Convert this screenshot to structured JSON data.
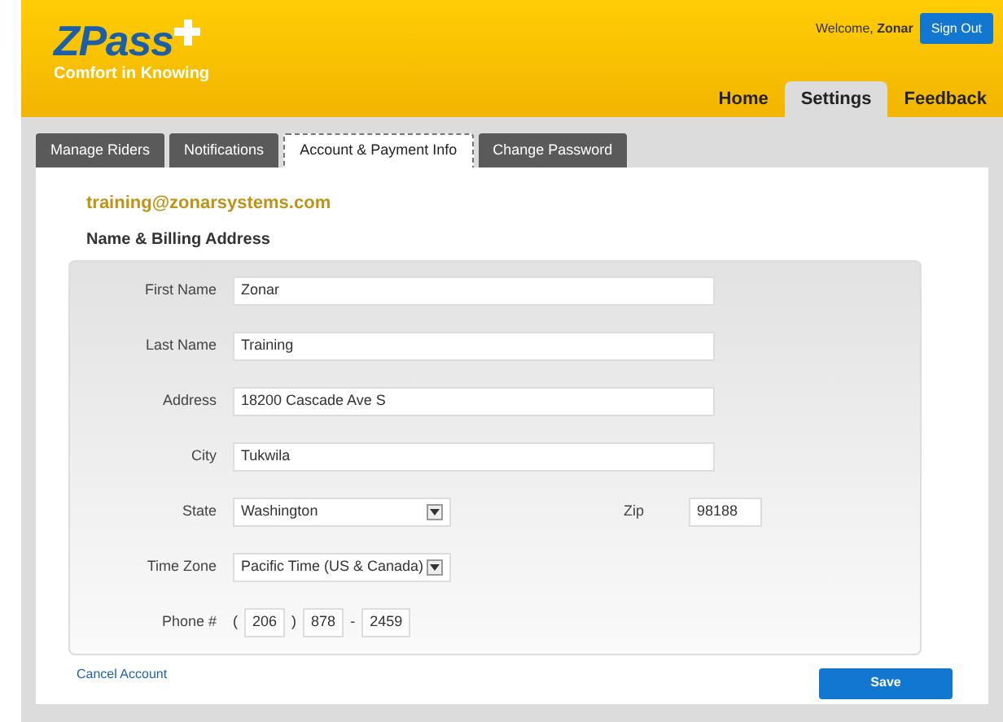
{
  "header": {
    "logo": "ZPass",
    "tagline": "Comfort in Knowing",
    "welcome": "Welcome,",
    "user": "Zonar",
    "sign_out": "Sign Out"
  },
  "nav": [
    {
      "label": "Home",
      "selected": false
    },
    {
      "label": "Settings",
      "selected": true
    },
    {
      "label": "Feedback",
      "selected": false
    }
  ],
  "tabs": [
    {
      "label": "Manage Riders",
      "selected": false
    },
    {
      "label": "Notifications",
      "selected": false
    },
    {
      "label": "Account & Payment Info",
      "selected": true
    },
    {
      "label": "Change Password",
      "selected": false
    }
  ],
  "email": "training@zonarsystems.com",
  "section_title": "Name & Billing Address",
  "rows": [
    {
      "kind": "text",
      "label": "First Name",
      "value": "Zonar"
    },
    {
      "kind": "text",
      "label": "Last Name",
      "value": "Training"
    },
    {
      "kind": "text",
      "label": "Address",
      "value": "18200 Cascade Ave S"
    },
    {
      "kind": "text",
      "label": "City",
      "value": "Tukwila"
    },
    {
      "kind": "select",
      "label": "State",
      "value": "Washington",
      "zip": {
        "label": "Zip",
        "value": "98188"
      }
    },
    {
      "kind": "select",
      "label": "Time Zone",
      "value": "Pacific Time (US & Canada)"
    },
    {
      "kind": "phone",
      "label": "Phone #",
      "open": "(",
      "area": "206",
      "close": ")",
      "prefix": "878",
      "dash": "-",
      "line": "2459"
    }
  ],
  "cancel": "Cancel Account",
  "save": "Save"
}
